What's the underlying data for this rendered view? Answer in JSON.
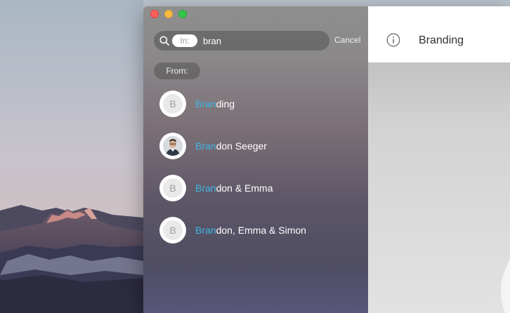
{
  "window": {
    "controls": {
      "close": "close",
      "minimize": "minimize",
      "maximize": "maximize"
    }
  },
  "search": {
    "scope_label": "In:",
    "query": "bran",
    "cancel_label": "Cancel",
    "icon": "search-icon"
  },
  "filter": {
    "from_label": "From:"
  },
  "results": [
    {
      "initial": "B",
      "highlight": "Bran",
      "rest": "ding",
      "avatar": "initial"
    },
    {
      "initial": "",
      "highlight": "Bran",
      "rest": "don Seeger",
      "avatar": "photo"
    },
    {
      "initial": "B",
      "highlight": "Bran",
      "rest": "don & Emma",
      "avatar": "initial"
    },
    {
      "initial": "B",
      "highlight": "Bran",
      "rest": "don, Emma & Simon",
      "avatar": "initial"
    }
  ],
  "conversation": {
    "title": "Branding",
    "info_icon": "info-icon"
  },
  "colors": {
    "highlight": "#3fb6e6",
    "close": "#fc605c",
    "minimize": "#fdbc40",
    "maximize": "#34c84a"
  }
}
